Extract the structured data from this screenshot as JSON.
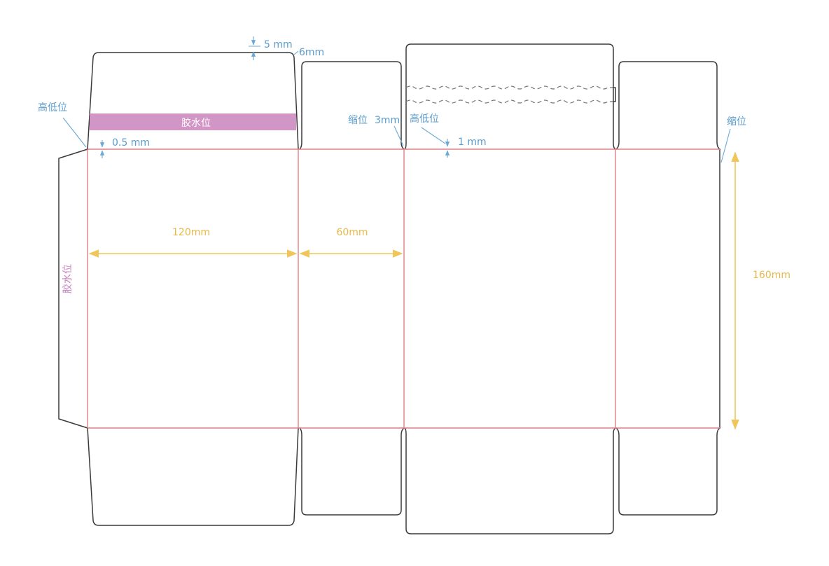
{
  "labels": {
    "glue_top": "胶水位",
    "glue_side": "胶水位",
    "dim_5mm": "5 mm",
    "dim_6mm": "6mm",
    "height_diff_left": "高低位",
    "height_diff_mid": "高低位",
    "dim_05mm": "0.5 mm",
    "shrink_mid": "缩位",
    "dim_3mm": "3mm",
    "dim_1mm": "1 mm",
    "shrink_right": "缩位",
    "width_120": "120mm",
    "width_60": "60mm",
    "height_160": "160mm"
  },
  "colors": {
    "outline": "#3a3a3a",
    "fold_line": "#e07f86",
    "dimension": "#f0c65a",
    "annotation": "#5a9ccd",
    "glue_area": "#d195c6"
  }
}
